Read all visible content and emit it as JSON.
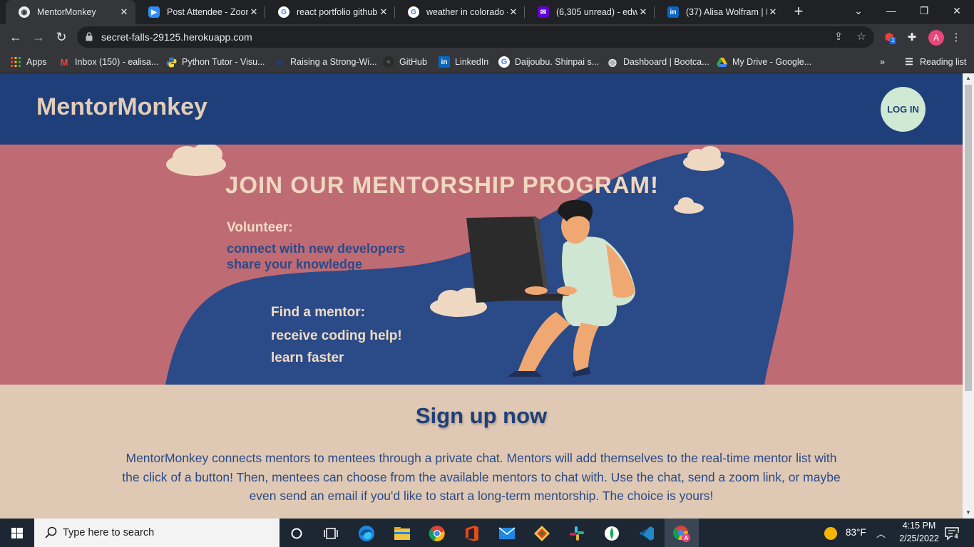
{
  "browser": {
    "tabs": [
      {
        "title": "MentorMonkey",
        "favicon": "chrome-globe-icon",
        "active": true
      },
      {
        "title": "Post Attendee - Zoom",
        "favicon": "zoom-icon",
        "active": false
      },
      {
        "title": "react portfolio github",
        "favicon": "google-icon",
        "active": false
      },
      {
        "title": "weather in colorado -",
        "favicon": "google-icon",
        "active": false
      },
      {
        "title": "(6,305 unread) - edwa",
        "favicon": "yahoo-mail-icon",
        "active": false
      },
      {
        "title": "(37) Alisa Wolfram | Li",
        "favicon": "linkedin-icon",
        "active": false
      }
    ],
    "url": "secret-falls-29125.herokuapp.com",
    "profile_initial": "A",
    "extension_badge": "1",
    "bookmarks": [
      {
        "label": "Apps",
        "icon": "apps-grid-icon"
      },
      {
        "label": "Inbox (150) - ealisa...",
        "icon": "gmail-icon"
      },
      {
        "label": "Python Tutor - Visu...",
        "icon": "python-icon"
      },
      {
        "label": "Raising a Strong-Wi...",
        "icon": "star-icon"
      },
      {
        "label": "GitHub",
        "icon": "github-icon"
      },
      {
        "label": "LinkedIn",
        "icon": "linkedin-icon"
      },
      {
        "label": "Daijoubu. Shinpai s...",
        "icon": "google-icon"
      },
      {
        "label": "Dashboard | Bootca...",
        "icon": "globe-icon"
      },
      {
        "label": "My Drive - Google...",
        "icon": "google-drive-icon"
      }
    ],
    "reading_list": "Reading list"
  },
  "site": {
    "brand": "MentorMonkey",
    "login_label": "LOG IN",
    "hero": {
      "title": "JOIN OUR MENTORSHIP PROGRAM!",
      "volunteer_heading": "Volunteer:",
      "volunteer_lines": [
        "connect with new developers",
        "share your knowledge"
      ],
      "mentor_heading": "Find a mentor:",
      "mentor_lines": [
        "receive coding help!",
        "learn faster"
      ]
    },
    "signup_title": "Sign up now",
    "signup_text": "MentorMonkey connects mentors to mentees through a private chat. Mentors will add themselves to the real-time mentor list with the click of a button! Then, mentees can choose from the available mentors to chat with. Use the chat, send a zoom link, or maybe even send an email if you'd like to start a long-term mentorship. The choice is yours!"
  },
  "taskbar": {
    "search_placeholder": "Type here to search",
    "weather": "83°F",
    "time": "4:15 PM",
    "date": "2/25/2022",
    "notification_count": "4"
  },
  "colors": {
    "header_blue": "#1e3f7a",
    "hero_pink": "#bf6b74",
    "page_beige": "#dfc9b4",
    "login_green": "#cfe9d3"
  }
}
